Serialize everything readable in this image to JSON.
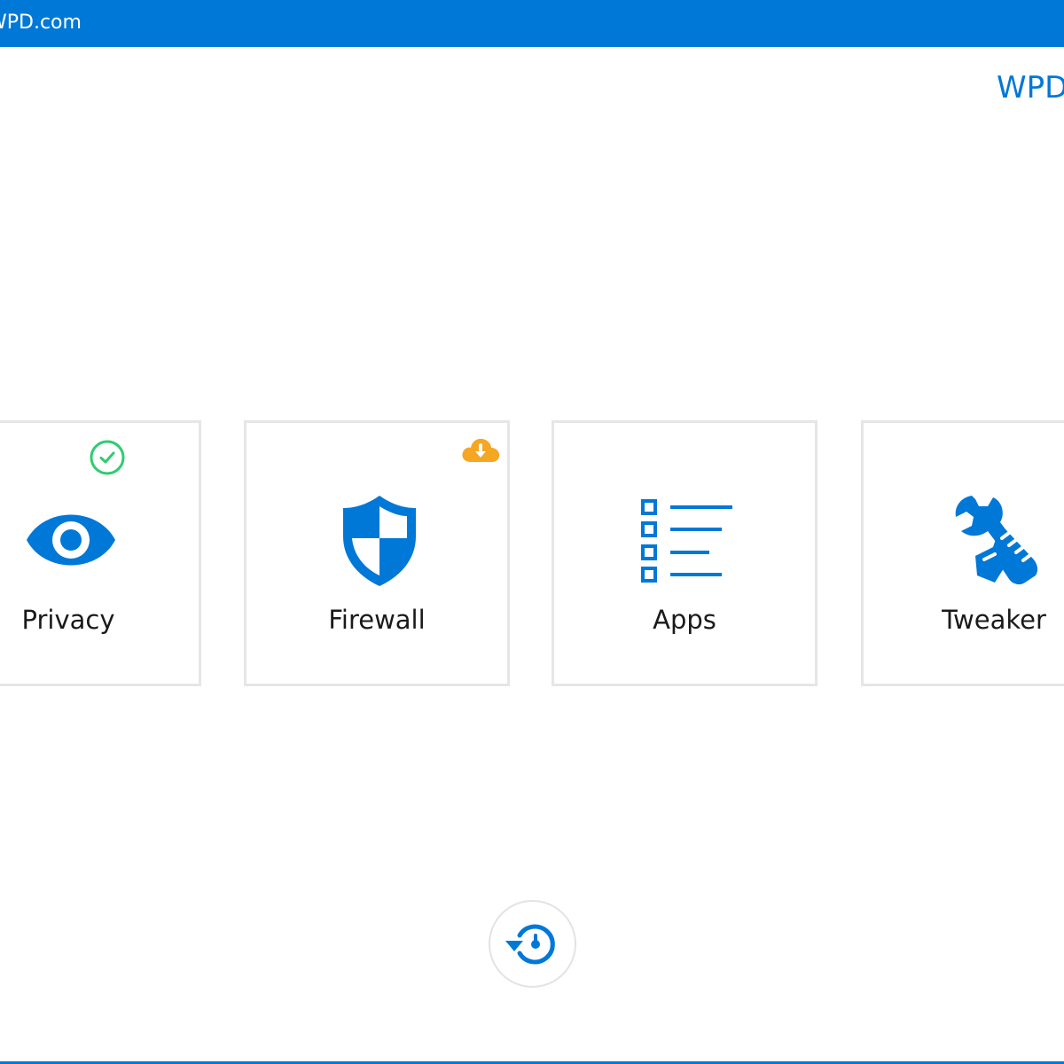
{
  "window": {
    "title": "WPD.com"
  },
  "header": {
    "brand_link": "WPD"
  },
  "colors": {
    "accent": "#0078d7",
    "tile_border": "#e6e6e6",
    "status_ok": "#2ecc71",
    "status_update": "#f5a623"
  },
  "tiles": [
    {
      "label": "Privacy",
      "icon": "eye-icon",
      "badge": "check-circle-icon"
    },
    {
      "label": "Firewall",
      "icon": "shield-icon",
      "badge": "cloud-download-icon"
    },
    {
      "label": "Apps",
      "icon": "list-icon",
      "badge": ""
    },
    {
      "label": "Tweaker",
      "icon": "wrench-hand-icon",
      "badge": ""
    }
  ],
  "footer": {
    "restore_icon": "restore-icon"
  }
}
